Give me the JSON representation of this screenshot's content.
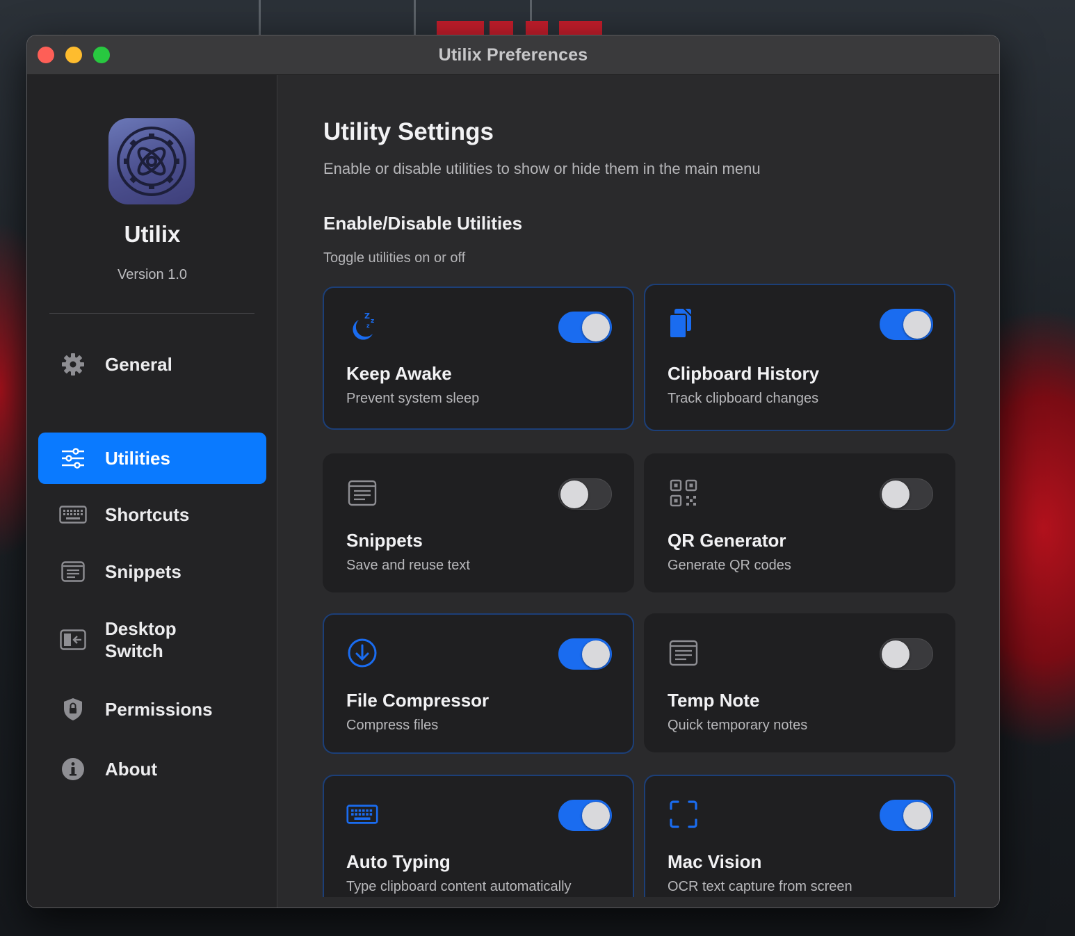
{
  "window": {
    "title": "Utilix Preferences"
  },
  "sidebar": {
    "app_name": "Utilix",
    "version": "Version 1.0",
    "items": [
      {
        "label": "General",
        "icon": "gear-icon",
        "active": false
      },
      {
        "label": "Utilities",
        "icon": "sliders-icon",
        "active": true
      },
      {
        "label": "Shortcuts",
        "icon": "keyboard-icon",
        "active": false
      },
      {
        "label": "Snippets",
        "icon": "snippets-icon",
        "active": false
      },
      {
        "label": "Desktop",
        "label2": "Switch",
        "icon": "desktop-switch-icon",
        "active": false
      },
      {
        "label": "Permissions",
        "icon": "shield-lock-icon",
        "active": false
      },
      {
        "label": "About",
        "icon": "info-icon",
        "active": false
      }
    ]
  },
  "main": {
    "title": "Utility Settings",
    "subtitle": "Enable or disable utilities to show or hide them in the main menu",
    "section_title": "Enable/Disable Utilities",
    "section_subtitle": "Toggle utilities on or off",
    "utilities": [
      {
        "title": "Keep Awake",
        "desc": "Prevent system sleep",
        "enabled": true,
        "icon": "moon-zzz-icon"
      },
      {
        "title": "Clipboard History",
        "desc": "Track clipboard changes",
        "enabled": true,
        "icon": "clipboard-icon"
      },
      {
        "title": "Snippets",
        "desc": "Save and reuse text",
        "enabled": false,
        "icon": "text-doc-icon"
      },
      {
        "title": "QR Generator",
        "desc": "Generate QR codes",
        "enabled": false,
        "icon": "qr-code-icon"
      },
      {
        "title": "File Compressor",
        "desc": "Compress files",
        "enabled": true,
        "icon": "download-circle-icon"
      },
      {
        "title": "Temp Note",
        "desc": "Quick temporary notes",
        "enabled": false,
        "icon": "note-icon"
      },
      {
        "title": "Auto Typing",
        "desc": "Type clipboard content automatically",
        "enabled": true,
        "icon": "keyboard-icon"
      },
      {
        "title": "Mac Vision",
        "desc": "OCR text capture from screen",
        "enabled": true,
        "icon": "viewfinder-icon"
      }
    ]
  },
  "colors": {
    "accent": "#0a7aff",
    "toggle_on": "#1a6cf0",
    "card_border_on": "#1c3f78"
  }
}
